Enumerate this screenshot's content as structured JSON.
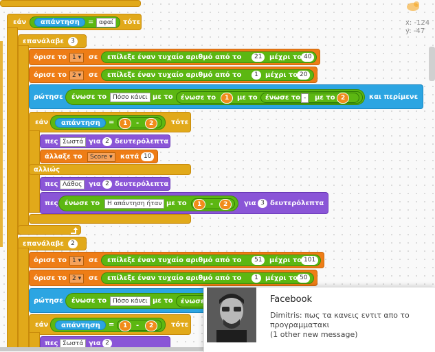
{
  "script": {
    "if1": {
      "label": "εάν",
      "sensor": "απάντηση",
      "eq": "=",
      "value": "αφαί",
      "then": "τότε"
    },
    "repeat1": {
      "label": "επανάλαβε",
      "count": "3"
    },
    "set1": {
      "label": "όρισε το",
      "var": "1",
      "to": "σε",
      "random": "επίλεξε έναν τυχαίο αριθμό από το",
      "from": "21",
      "upto": "μέχρι το",
      "to_val": "40"
    },
    "set2": {
      "label": "όρισε το",
      "var": "2",
      "to": "σε",
      "random": "επίλεξε έναν τυχαίο αριθμό από το",
      "from": "1",
      "upto": "μέχρι το",
      "to_val": "20"
    },
    "ask1": {
      "label": "ρώτησε",
      "join": "ένωσε το",
      "text": "Πόσο κάνει",
      "with": "με το",
      "join2": "ένωσε το",
      "v1": "1",
      "with2": "με το",
      "join3": "ένωσε το",
      "minus": "-",
      "with3": "με το",
      "v2": "2",
      "wait": "και περίμενε"
    },
    "if2": {
      "label": "εάν",
      "sensor": "απάντηση",
      "eq": "=",
      "a": "1",
      "op": "-",
      "b": "2",
      "then": "τότε"
    },
    "say1": {
      "label": "πες",
      "text": "Σωστά",
      "for": "για",
      "secs": "2",
      "unit": "δευτερόλεπτα"
    },
    "change1": {
      "label": "άλλαξε το",
      "var": "Score",
      "by": "κατά",
      "val": "10"
    },
    "else": {
      "label": "αλλιώς"
    },
    "say2": {
      "label": "πες",
      "text": "Λάθος",
      "for": "για",
      "secs": "2",
      "unit": "δευτερόλεπτα"
    },
    "say3": {
      "label": "πες",
      "join": "ένωσε το",
      "text": "Η απάντηση ήταν",
      "with": "με το",
      "a": "1",
      "op": "-",
      "b": "2",
      "for": "για",
      "secs": "3",
      "unit": "δευτερόλεπτα"
    },
    "repeat2": {
      "label": "επανάλαβε",
      "count": "2"
    },
    "set3": {
      "label": "όρισε το",
      "var": "1",
      "to": "σε",
      "random": "επίλεξε έναν τυχαίο αριθμό από το",
      "from": "51",
      "upto": "μέχρι το",
      "to_val": "101"
    },
    "set4": {
      "label": "όρισε το",
      "var": "2",
      "to": "σε",
      "random": "επίλεξε έναν τυχαίο αριθμό από το",
      "from": "1",
      "upto": "μέχρι το",
      "to_val": "50"
    },
    "ask2": {
      "label": "ρώτησε",
      "join": "ένωσε το",
      "text": "Πόσο κάνει",
      "with": "με το",
      "join2": "ένωσε"
    },
    "if3": {
      "label": "εάν",
      "sensor": "απάντηση",
      "eq": "=",
      "a": "1",
      "op": "-",
      "b": "2",
      "then": "τότε"
    },
    "say4": {
      "label": "πες",
      "text": "Σωστά",
      "for": "για",
      "secs": "2"
    }
  },
  "coords": {
    "x": "x: -124",
    "y": "y: -47"
  },
  "notification": {
    "app": "Facebook",
    "message": "Dimitris: πως τα κανεις εντιτ απο το προγραμματακι",
    "extra": "(1 other new message)"
  },
  "colors": {
    "control": "#e1a91a",
    "data": "#ee7d16",
    "operators": "#5cb712",
    "sensing": "#2ca5e2",
    "looks": "#8a55d7"
  }
}
